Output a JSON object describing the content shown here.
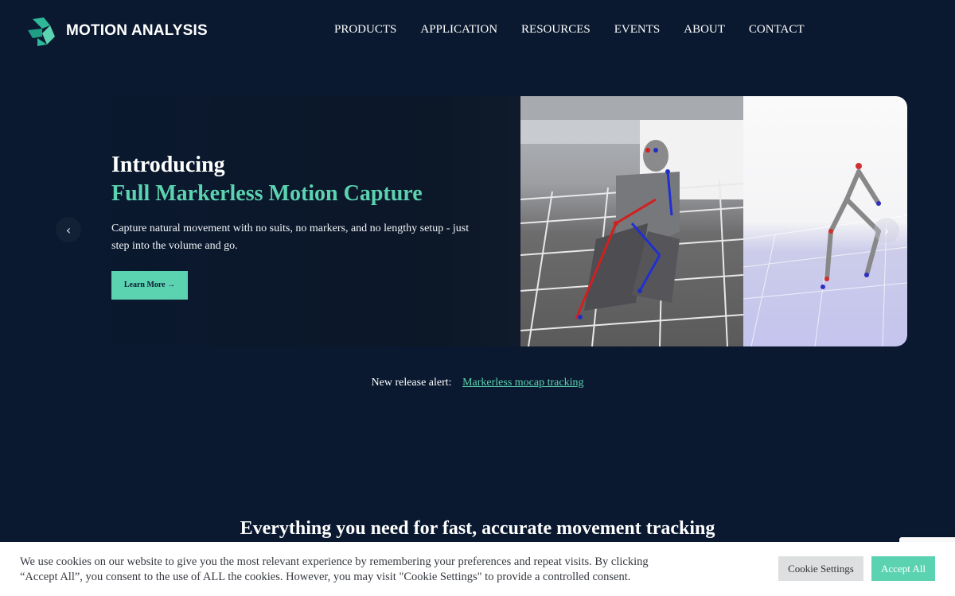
{
  "brand": {
    "name": "MOTION ANALYSIS",
    "accent": "#5cd3b0",
    "background": "#0a1930"
  },
  "nav": {
    "items": [
      {
        "label": "PRODUCTS"
      },
      {
        "label": "APPLICATION"
      },
      {
        "label": "RESOURCES"
      },
      {
        "label": "EVENTS"
      },
      {
        "label": "ABOUT"
      },
      {
        "label": "CONTACT"
      }
    ]
  },
  "hero": {
    "title_line1": "Introducing",
    "title_line2": "Full Markerless Motion Capture",
    "description": "Capture natural movement with no suits, no markers, and no lengthy setup - just step into the volume and go.",
    "button_label": "Learn More →",
    "prev_icon": "chevron-left-icon",
    "next_icon": "chevron-right-icon"
  },
  "release": {
    "label": "New release alert:",
    "link_text": "Markerless mocap tracking"
  },
  "section": {
    "title": "Everything you need for fast, accurate movement tracking"
  },
  "cookie": {
    "text": "We use cookies on our website to give you the most relevant experience by remembering your preferences and repeat visits. By clicking “Accept All”, you consent to the use of ALL the cookies. However, you may visit \"Cookie Settings\" to provide a controlled consent.",
    "settings_label": "Cookie Settings",
    "accept_label": "Accept All"
  }
}
